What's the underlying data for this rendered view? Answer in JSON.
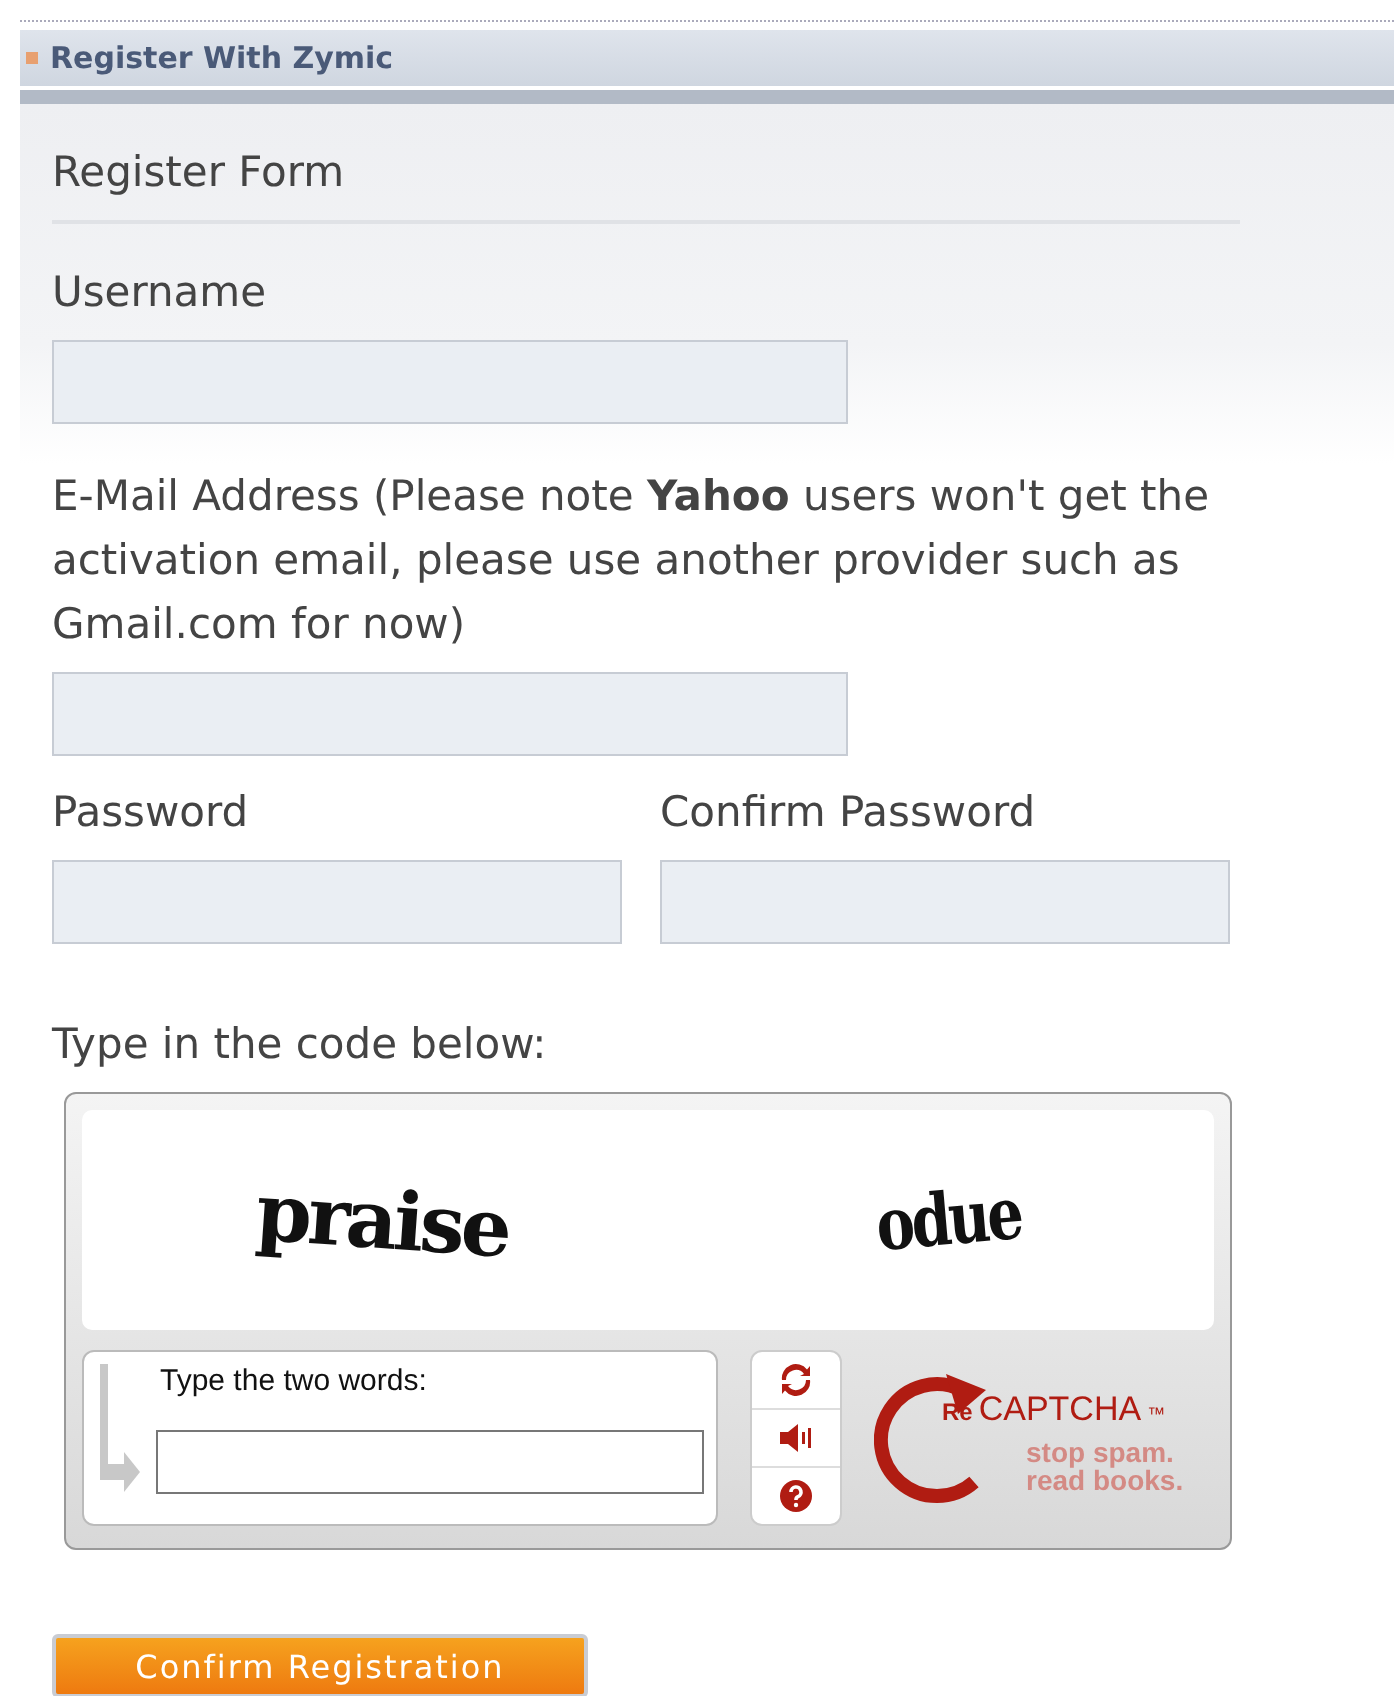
{
  "header": {
    "title": "Register With Zymic"
  },
  "form": {
    "title": "Register Form",
    "fields": [
      {
        "kind": "full",
        "label": "Username"
      },
      {
        "kind": "full",
        "label": "E-Mail Address (Please note **Yahoo** users won't get the activation email, please use another provider such as Gmail.com for now)"
      }
    ],
    "pair": [
      {
        "label": "Password"
      },
      {
        "label": "Confirm Password"
      }
    ],
    "captcha_prompt": "Type in the code below:"
  },
  "captcha": {
    "words": [
      "praise",
      "odue"
    ],
    "input_label": "Type the two words:",
    "logo_re": "Re",
    "logo_name": "CAPTCHA",
    "logo_tm": "™",
    "tagline": [
      "stop spam.",
      "read books."
    ]
  },
  "submit": {
    "label": "Confirm Registration"
  }
}
